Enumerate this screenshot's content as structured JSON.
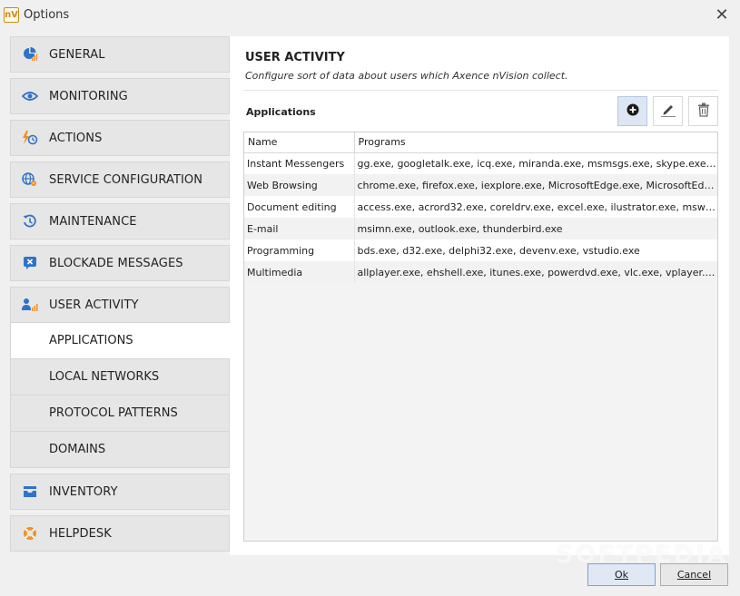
{
  "window": {
    "title": "Options",
    "icon_text": "nV"
  },
  "sidebar": {
    "items_top": [
      {
        "label": "GENERAL",
        "icon": "chart-pie-icon"
      },
      {
        "label": "MONITORING",
        "icon": "eye-icon"
      },
      {
        "label": "ACTIONS",
        "icon": "bolt-clock-icon"
      },
      {
        "label": "SERVICE CONFIGURATION",
        "icon": "globe-gear-icon"
      },
      {
        "label": "MAINTENANCE",
        "icon": "history-icon"
      },
      {
        "label": "BLOCKADE MESSAGES",
        "icon": "message-x-icon"
      }
    ],
    "active_group": {
      "label": "USER ACTIVITY",
      "icon": "user-chart-icon",
      "sub_items": [
        "APPLICATIONS",
        "LOCAL NETWORKS",
        "PROTOCOL PATTERNS",
        "DOMAINS"
      ],
      "active_sub": "APPLICATIONS"
    },
    "items_bottom": [
      {
        "label": "INVENTORY",
        "icon": "inbox-icon"
      },
      {
        "label": "HELPDESK",
        "icon": "lifebuoy-icon"
      }
    ]
  },
  "content": {
    "title": "USER ACTIVITY",
    "description": "Configure sort of data about users which Axence nVision collect.",
    "section_label": "Applications",
    "toolbar": {
      "add": "add-icon",
      "edit": "edit-icon",
      "delete": "trash-icon"
    },
    "table": {
      "columns": [
        "Name",
        "Programs"
      ],
      "rows": [
        [
          "Instant Messengers",
          "gg.exe, googletalk.exe, icq.exe, miranda.exe, msmsgs.exe, skype.exe, tlen.exe"
        ],
        [
          "Web Browsing",
          "chrome.exe, firefox.exe, iexplore.exe, MicrosoftEdge.exe, MicrosoftEdgeCP.exe"
        ],
        [
          "Document editing",
          "access.exe, acrord32.exe, coreldrv.exe, excel.exe, ilustrator.exe, msworks.exe"
        ],
        [
          "E-mail",
          "msimn.exe, outlook.exe, thunderbird.exe"
        ],
        [
          "Programming",
          "bds.exe, d32.exe, delphi32.exe, devenv.exe, vstudio.exe"
        ],
        [
          "Multimedia",
          "allplayer.exe, ehshell.exe, itunes.exe, powerdvd.exe, vlc.exe, vplayer.exe, winamp.exe"
        ]
      ]
    }
  },
  "footer": {
    "ok_label": "Ok",
    "cancel_label": "Cancel"
  },
  "watermark": "SOFTPEDIA",
  "colors": {
    "accent_blue": "#2f73c9",
    "accent_orange": "#f0902a",
    "active_bg": "#ffffff",
    "nav_bg": "#e6e6e6"
  }
}
